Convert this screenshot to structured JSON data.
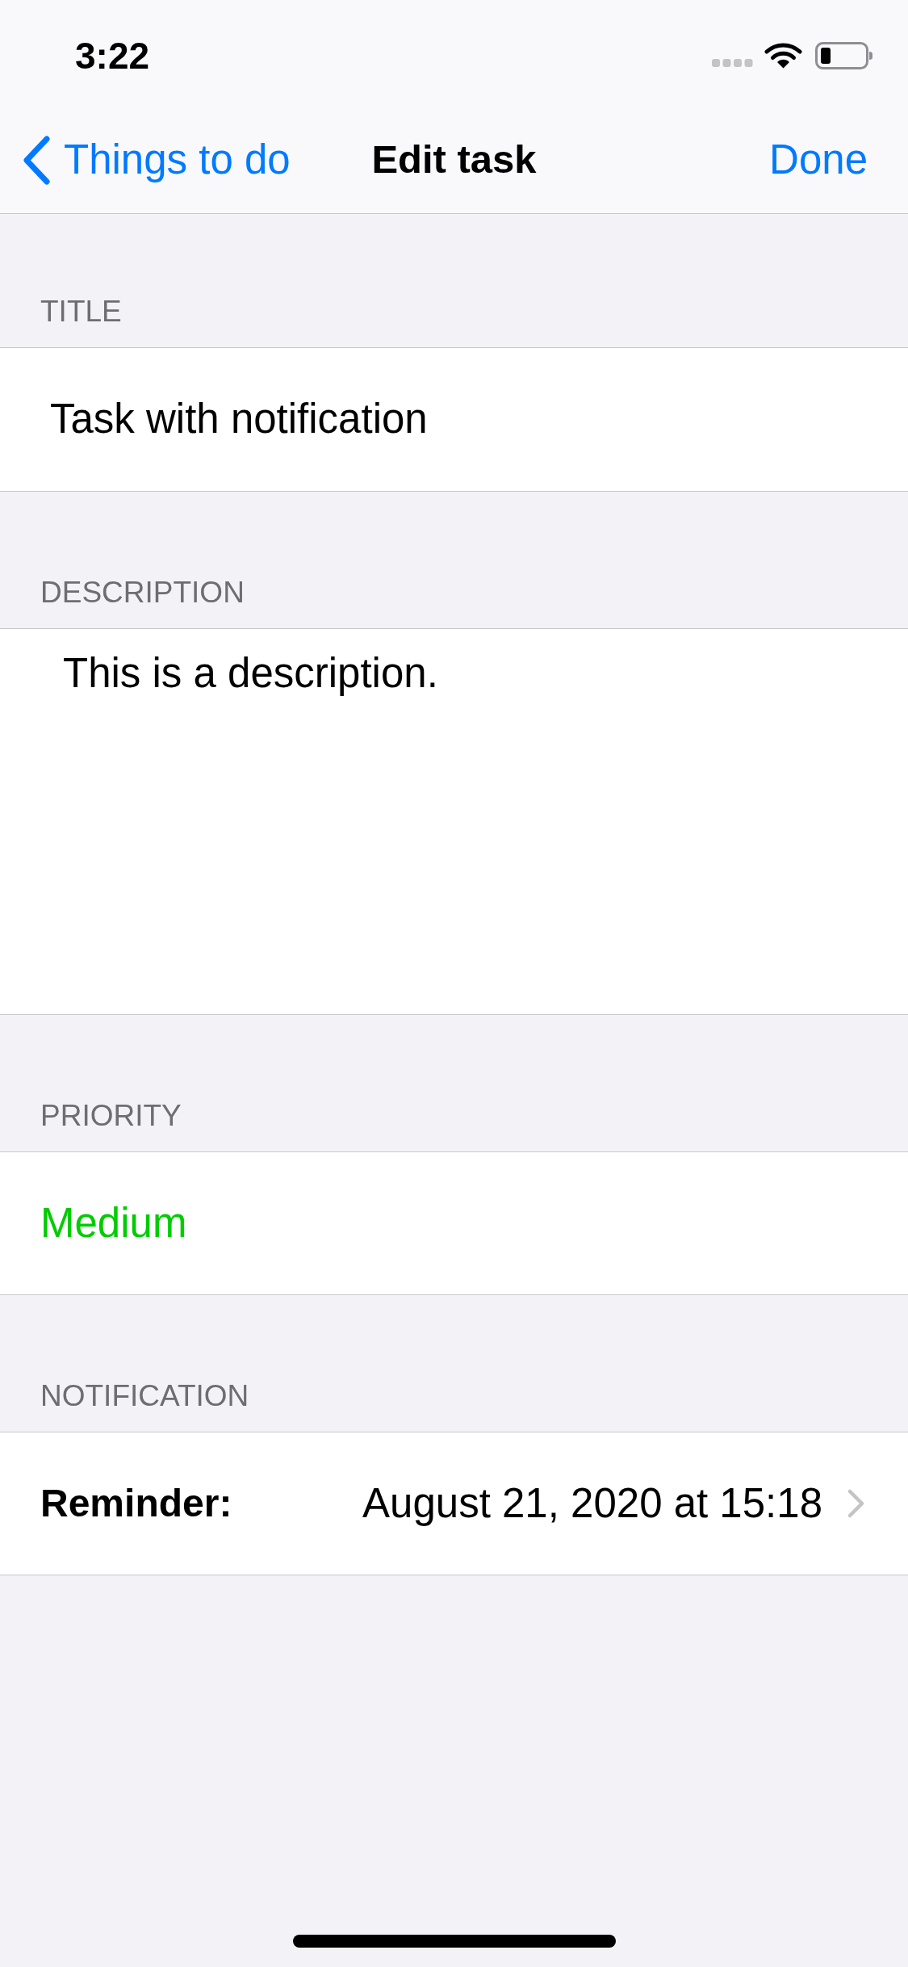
{
  "status_bar": {
    "time": "3:22"
  },
  "nav_bar": {
    "back_label": "Things to do",
    "title": "Edit task",
    "done_label": "Done"
  },
  "sections": [
    {
      "header": "TITLE",
      "kind": "text",
      "value": "Task with notification"
    },
    {
      "header": "DESCRIPTION",
      "kind": "textarea",
      "value": "This is a description."
    },
    {
      "header": "PRIORITY",
      "kind": "picker",
      "value": "Medium",
      "color": "#00cc00"
    },
    {
      "header": "NOTIFICATION",
      "kind": "detail",
      "label": "Reminder:",
      "value": "August 21, 2020 at 15:18"
    }
  ]
}
